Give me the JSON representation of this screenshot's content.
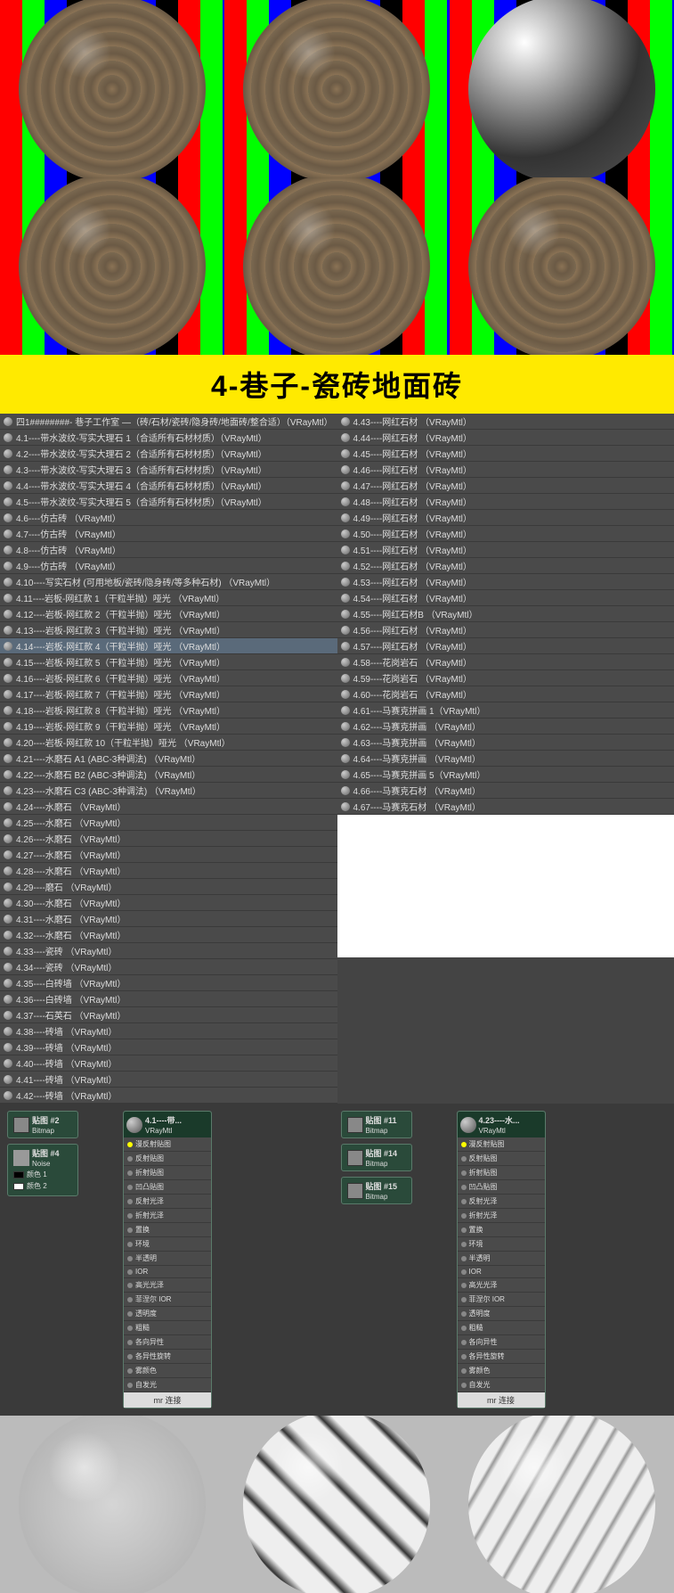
{
  "banner": "4-巷子-瓷砖地面砖",
  "list_left": [
    "四1########- 巷子工作室 —（砖/石材/瓷砖/隐身砖/地面砖/整合适）（VRayMtl）",
    "4.1----带水波纹-写实大理石 1（合适所有石材材质）（VRayMtl）",
    "4.2----带水波纹-写实大理石 2（合适所有石材材质）（VRayMtl）",
    "4.3----带水波纹-写实大理石 3（合适所有石材材质）（VRayMtl）",
    "4.4----带水波纹-写实大理石 4（合适所有石材材质）（VRayMtl）",
    "4.5----带水波纹-写实大理石 5（合适所有石材材质）（VRayMtl）",
    "4.6----仿古砖 （VRayMtl）",
    "4.7----仿古砖 （VRayMtl）",
    "4.8----仿古砖 （VRayMtl）",
    "4.9----仿古砖 （VRayMtl）",
    "4.10----写实石材 (可用地板/瓷砖/隐身砖/等多种石材) （VRayMtl）",
    "4.11----岩板-网红款 1（干粒半抛）哑光 （VRayMtl）",
    "4.12----岩板-网红款 2（干粒半抛）哑光 （VRayMtl）",
    "4.13----岩板-网红款 3（干粒半抛）哑光 （VRayMtl）",
    "4.14----岩板-网红款 4（干粒半抛）哑光 （VRayMtl）",
    "4.15----岩板-网红款 5（干粒半抛）哑光 （VRayMtl）",
    "4.16----岩板-网红款 6（干粒半抛）哑光 （VRayMtl）",
    "4.17----岩板-网红款 7（干粒半抛）哑光 （VRayMtl）",
    "4.18----岩板-网红款 8（干粒半抛）哑光 （VRayMtl）",
    "4.19----岩板-网红款 9（干粒半抛）哑光 （VRayMtl）",
    "4.20----岩板-网红款 10（干粒半抛）哑光 （VRayMtl）",
    "4.21----水磨石 A1 (ABC-3种调法) （VRayMtl）",
    "4.22----水磨石 B2 (ABC-3种调法) （VRayMtl）",
    "4.23----水磨石 C3 (ABC-3种调法) （VRayMtl）",
    "4.24----水磨石 （VRayMtl）",
    "4.25----水磨石 （VRayMtl）",
    "4.26----水磨石 （VRayMtl）",
    "4.27----水磨石 （VRayMtl）",
    "4.28----水磨石 （VRayMtl）",
    "4.29----磨石 （VRayMtl）",
    "4.30----水磨石 （VRayMtl）",
    "4.31----水磨石 （VRayMtl）",
    "4.32----水磨石 （VRayMtl）",
    "4.33----瓷砖 （VRayMtl）",
    "4.34----瓷砖 （VRayMtl）",
    "4.35----白砖墙 （VRayMtl）",
    "4.36----白砖墙 （VRayMtl）",
    "4.37----石英石 （VRayMtl）",
    "4.38----砖墙 （VRayMtl）",
    "4.39----砖墙 （VRayMtl）",
    "4.40----砖墙 （VRayMtl）",
    "4.41----砖墙 （VRayMtl）",
    "4.42----砖墙 （VRayMtl）"
  ],
  "list_right": [
    "4.43----网红石材 （VRayMtl）",
    "4.44----网红石材 （VRayMtl）",
    "4.45----网红石材 （VRayMtl）",
    "4.46----网红石材 （VRayMtl）",
    "4.47----网红石材 （VRayMtl）",
    "4.48----网红石材 （VRayMtl）",
    "4.49----网红石材 （VRayMtl）",
    "4.50----网红石材 （VRayMtl）",
    "4.51----网红石材 （VRayMtl）",
    "4.52----网红石材 （VRayMtl）",
    "4.53----网红石材 （VRayMtl）",
    "4.54----网红石材 （VRayMtl）",
    "4.55----网红石材B （VRayMtl）",
    "4.56----网红石材 （VRayMtl）",
    "4.57----网红石材 （VRayMtl）",
    "4.58----花岗岩石 （VRayMtl）",
    "4.59----花岗岩石 （VRayMtl）",
    "4.60----花岗岩石 （VRayMtl）",
    "4.61----马赛克拼画 1（VRayMtl）",
    "4.62----马赛克拼画 （VRayMtl）",
    "4.63----马赛克拼画 （VRayMtl）",
    "4.64----马赛克拼画 （VRayMtl）",
    "4.65----马赛克拼画 5（VRayMtl）",
    "4.66----马赛克石材 （VRayMtl）",
    "4.67----马赛克石材 （VRayMtl）"
  ],
  "selected_left_idx": 14,
  "graph1": {
    "bitmaps": [
      {
        "label": "贴图 #2",
        "type": "Bitmap"
      },
      {
        "label": "贴图 #4",
        "type": "Noise",
        "c1": "颜色 1",
        "c2": "颜色 2"
      }
    ],
    "mat_title": "4.1----带...",
    "mat_type": "VRayMtl",
    "slots": [
      "漫反射贴图",
      "反射贴图",
      "折射贴图",
      "凹凸贴图",
      "反射光泽",
      "折射光泽",
      "置换",
      "环境",
      "半透明",
      "IOR",
      "高光光泽",
      "菲涅尔 IOR",
      "透明度",
      "粗糙",
      "各向异性",
      "各异性旋转",
      "雾颜色",
      "自发光"
    ],
    "footer": "mr 连接"
  },
  "graph2": {
    "bitmaps": [
      {
        "label": "贴图 #11",
        "type": "Bitmap"
      },
      {
        "label": "贴图 #14",
        "type": "Bitmap"
      },
      {
        "label": "贴图 #15",
        "type": "Bitmap"
      }
    ],
    "mat_title": "4.23----水...",
    "mat_type": "VRayMtl",
    "slots": [
      "漫反射贴图",
      "反射贴图",
      "折射贴图",
      "凹凸贴图",
      "反射光泽",
      "折射光泽",
      "置换",
      "环境",
      "半透明",
      "IOR",
      "高光光泽",
      "菲涅尔 IOR",
      "透明度",
      "粗糙",
      "各向异性",
      "各异性旋转",
      "雾颜色",
      "自发光"
    ],
    "footer": "mr 连接"
  }
}
